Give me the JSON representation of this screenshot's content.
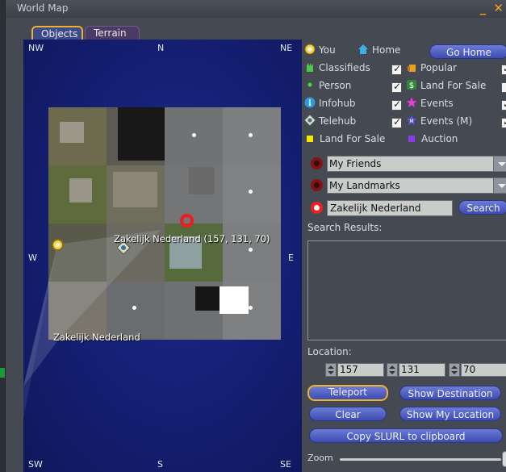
{
  "window": {
    "title": "World Map",
    "minimize_label": "_",
    "close_label": "✕"
  },
  "tabs": [
    {
      "label": "Objects",
      "active": true
    },
    {
      "label": "Terrain",
      "active": false
    }
  ],
  "map": {
    "compass": {
      "nw": "NW",
      "n": "N",
      "ne": "NE",
      "w": "W",
      "e": "E",
      "sw": "SW",
      "s": "S",
      "se": "SE"
    },
    "region_label": "Zakelijk Nederland",
    "hover_label": "Zakelijk Nederland (157, 131, 70)"
  },
  "legend": {
    "you": "You",
    "home": "Home",
    "go_home": "Go Home",
    "classifieds": "Classifieds",
    "popular": "Popular",
    "person": "Person",
    "land_for_sale": "Land For Sale",
    "infohub": "Infohub",
    "events": "Events",
    "telehub": "Telehub",
    "events_m": "Events (M)",
    "land_for_sale_2": "Land For Sale",
    "auction": "Auction"
  },
  "checkboxes": {
    "classifieds": true,
    "popular": true,
    "person": true,
    "land_for_sale": false,
    "infohub": true,
    "events": true,
    "telehub": true,
    "events_m": true
  },
  "friends_dropdown": "My Friends",
  "landmarks_dropdown": "My Landmarks",
  "search": {
    "value": "Zakelijk Nederland",
    "button": "Search",
    "results_label": "Search Results:"
  },
  "location": {
    "label": "Location:",
    "x": "157",
    "y": "131",
    "z": "70"
  },
  "buttons": {
    "teleport": "Teleport",
    "show_destination": "Show Destination",
    "clear": "Clear",
    "show_my_location": "Show My Location",
    "copy_slurl": "Copy SLURL to clipboard"
  },
  "zoom": {
    "label": "Zoom",
    "level": 1.0
  },
  "colors": {
    "accent": "#f0b030",
    "button": "#5565c8",
    "map_bg": "#151f72",
    "marker_red": "#ee1c1c"
  }
}
